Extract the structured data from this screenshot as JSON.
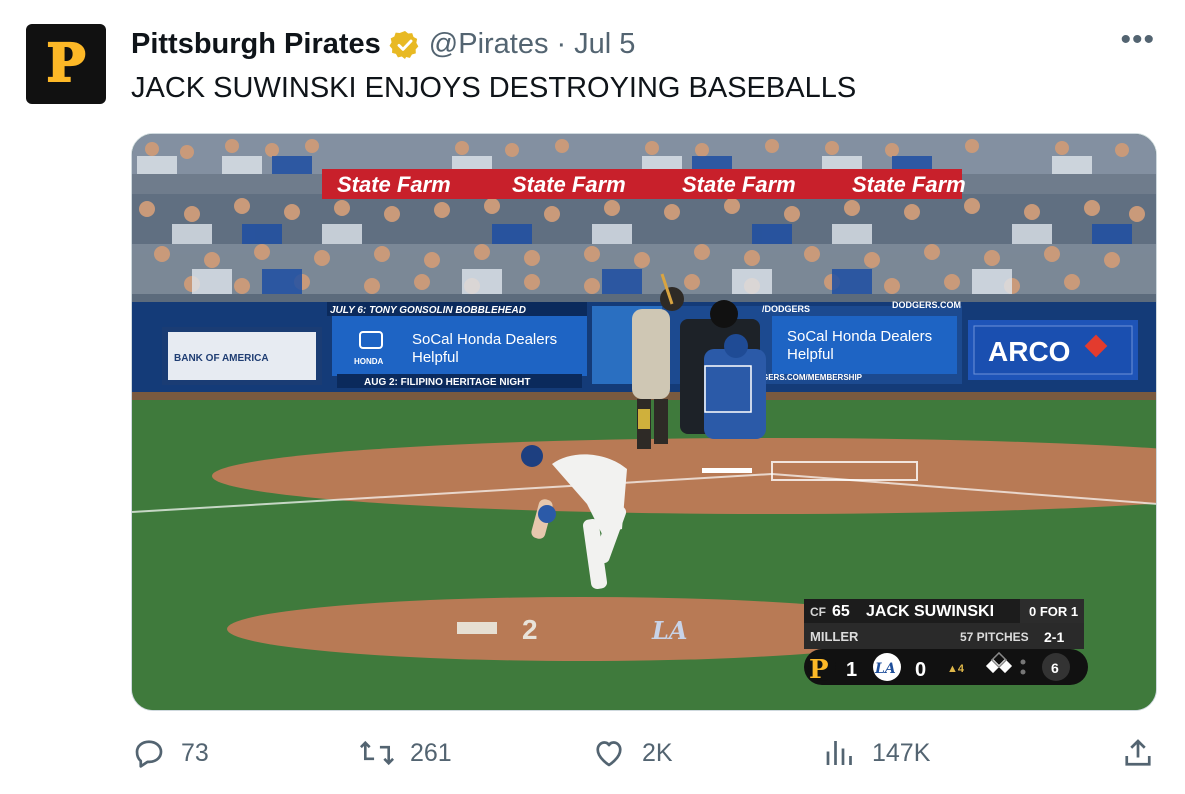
{
  "account": {
    "avatar_letter": "P",
    "display_name": "Pittsburgh Pirates",
    "handle": "@Pirates",
    "separator": "·",
    "date": "Jul 5",
    "more_label": "•••"
  },
  "tweet": {
    "text": "JACK SUWINSKI ENJOYS DESTROYING BASEBALLS"
  },
  "media": {
    "ads": {
      "statefarm": "State Farm",
      "bobblehead": "JULY 6: TONY GONSOLIN BOBBLEHEAD",
      "honda_line1": "SoCal Honda Dealers",
      "honda_line2": "Helpful",
      "honda_brand": "HONDA",
      "filipino": "AUG 2: FILIPINO HERITAGE NIGHT",
      "bank": "BANK OF AMERICA",
      "arco": "ARCO",
      "dodgers_site": "DODGERS.COM",
      "dodgers_tag": "/DODGERS",
      "membership": "GERS.COM/MEMBERSHIP"
    },
    "scorebug": {
      "position": "CF",
      "number": "65",
      "batter": "JACK SUWINSKI",
      "batter_line": "0 FOR 1",
      "pitcher": "MILLER",
      "pitches": "57 PITCHES",
      "count": "2-1",
      "away_logo": "P",
      "away_score": "1",
      "home_logo": "LA",
      "home_score": "0",
      "inning": "▲4",
      "outs_dot": "•",
      "pitch_speed": "6"
    }
  },
  "actions": {
    "replies": "73",
    "retweets": "261",
    "likes": "2K",
    "views": "147K"
  },
  "colors": {
    "verified": "#e8b923",
    "secondary_text": "#536471",
    "pirates_gold": "#fdb827"
  }
}
